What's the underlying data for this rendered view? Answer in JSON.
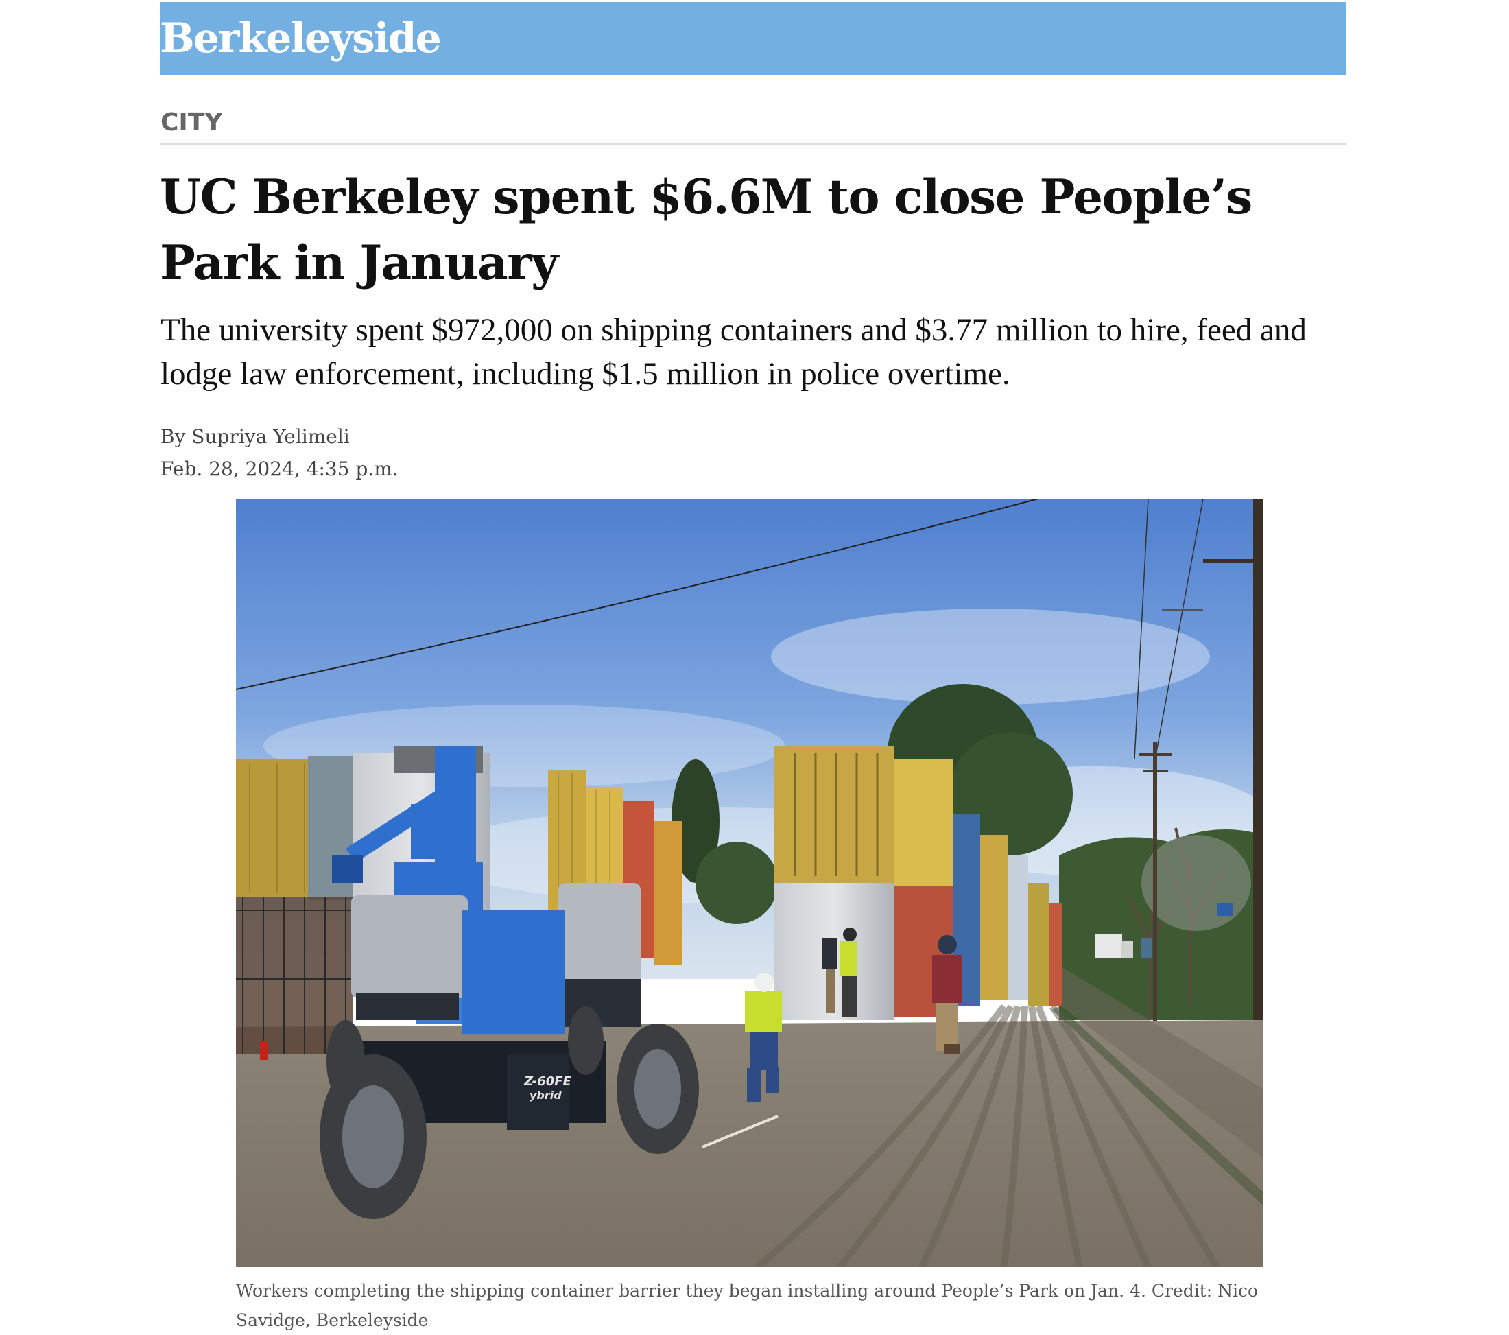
{
  "masthead": {
    "logo": "Berkeleyside",
    "color": "#74afe2"
  },
  "article": {
    "section": "CITY",
    "headline": "UC Berkeley spent $6.6M to close People’s Park in January",
    "dek": "The university spent $972,000 on shipping containers and $3.77 million to hire, feed and lodge law enforcement, including $1.5 million in police overtime.",
    "byline": "By Supriya Yelimeli",
    "date": "Feb. 28, 2024, 4:35 p.m.",
    "photo": {
      "machine_label_1": "Z-60FE",
      "machine_label_2": "ybrid",
      "caption": "Workers completing the shipping container barrier they began installing around People’s Park on Jan. 4. Credit: Nico Savidge, Berkeleyside"
    }
  }
}
